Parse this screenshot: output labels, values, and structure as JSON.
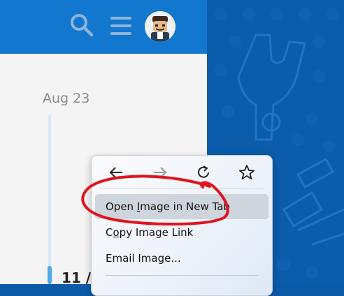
{
  "header": {
    "search_icon": "search-icon",
    "menu_icon": "hamburger-menu-icon",
    "avatar": "user-avatar"
  },
  "timeline": {
    "date_label": "Aug 23",
    "post_number": "11 /"
  },
  "context_menu": {
    "nav": [
      "back-arrow-icon",
      "forward-arrow-icon",
      "reload-icon",
      "bookmark-star-icon"
    ],
    "items": [
      {
        "pre": "Open ",
        "accel": "I",
        "post": "mage in New Tab"
      },
      {
        "pre": "C",
        "accel": "o",
        "post": "py Image Link"
      },
      {
        "pre": "Email Ima",
        "accel": "g",
        "post": "e..."
      }
    ]
  },
  "colors": {
    "header": "#1177cf",
    "background_pattern": "#0b5cab",
    "annotation": "#e0141e",
    "highlight": "#cfd5dc"
  }
}
